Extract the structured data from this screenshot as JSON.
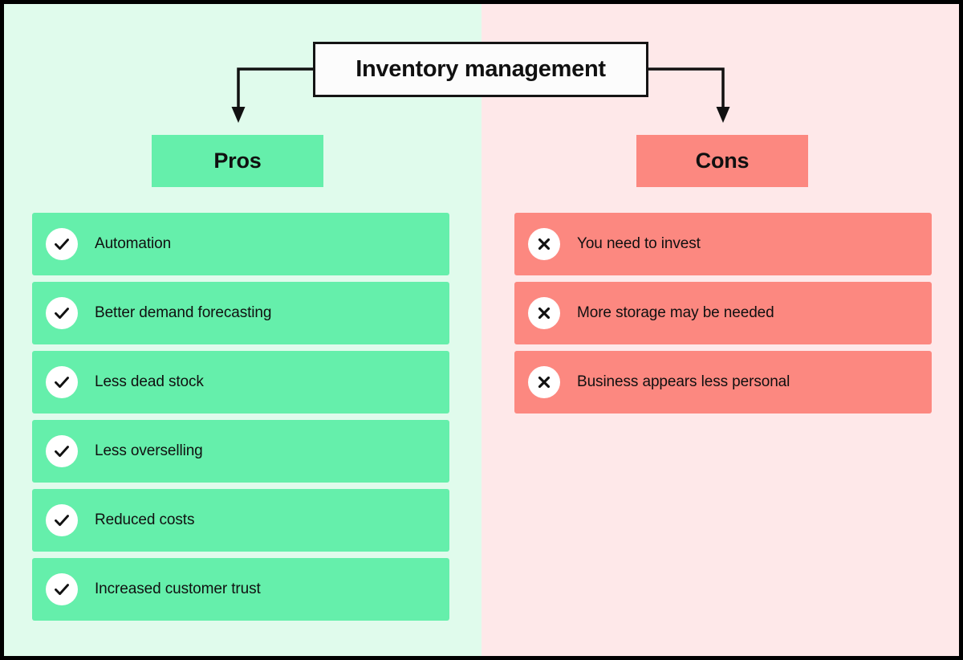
{
  "title": {
    "text": "Inventory management"
  },
  "columns": {
    "pros": {
      "header": "Pros",
      "icon": "check-icon",
      "color": "#65efab",
      "background": "#e0fbec",
      "items": [
        {
          "label": "Automation"
        },
        {
          "label": "Better demand forecasting"
        },
        {
          "label": "Less dead stock"
        },
        {
          "label": "Less overselling"
        },
        {
          "label": "Reduced costs"
        },
        {
          "label": "Increased customer trust"
        }
      ]
    },
    "cons": {
      "header": "Cons",
      "icon": "cross-icon",
      "color": "#fc8880",
      "background": "#fee8e9",
      "items": [
        {
          "label": "You need to invest"
        },
        {
          "label": "More storage may be needed"
        },
        {
          "label": "Business appears less personal"
        }
      ]
    }
  },
  "colors": {
    "frame": "#000000",
    "title_border": "#141414",
    "title_fill": "#fcfcfc",
    "text": "#101010",
    "badge_fill": "#ffffff",
    "pros_accent": "#65efab",
    "cons_accent": "#fc8880",
    "pros_background": "#e0fbec",
    "cons_background": "#fee8e9"
  }
}
